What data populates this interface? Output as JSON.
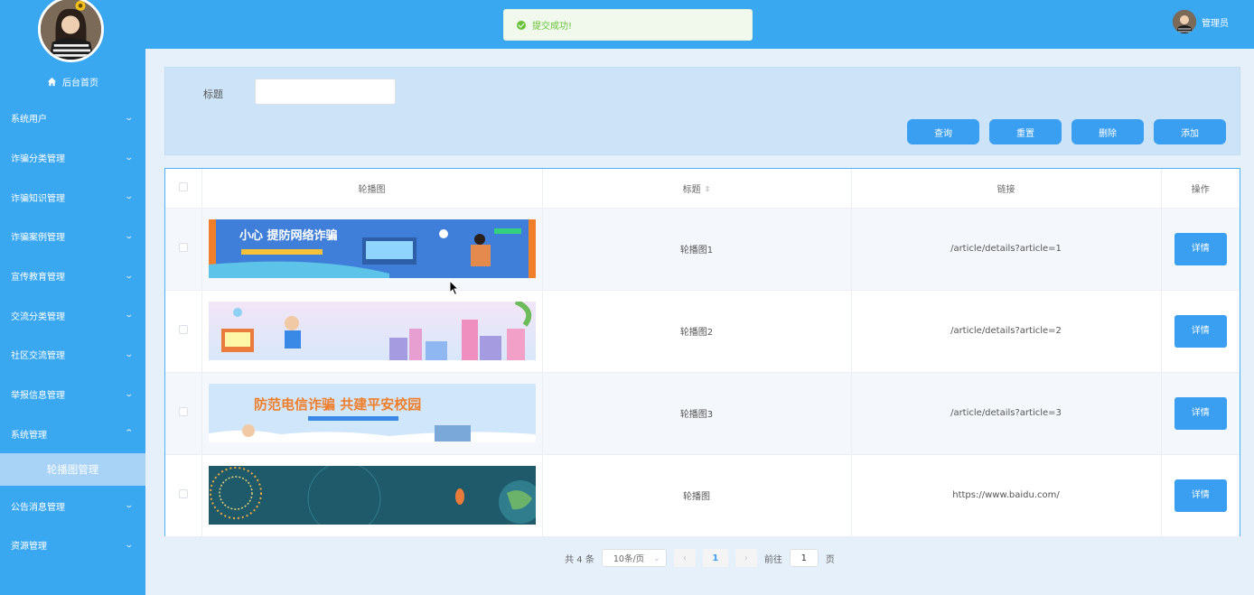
{
  "toast": {
    "message": "提交成功!"
  },
  "header": {
    "username": "管理员"
  },
  "sidebar": {
    "home_label": "后台首页",
    "items": [
      {
        "label": "系统用户",
        "chevron": "⌄"
      },
      {
        "label": "诈骗分类管理",
        "chevron": "⌄"
      },
      {
        "label": "诈骗知识管理",
        "chevron": "⌄"
      },
      {
        "label": "诈骗案例管理",
        "chevron": "⌄"
      },
      {
        "label": "宣传教育管理",
        "chevron": "⌄"
      },
      {
        "label": "交流分类管理",
        "chevron": "⌄"
      },
      {
        "label": "社区交流管理",
        "chevron": "⌄"
      },
      {
        "label": "举报信息管理",
        "chevron": "⌄"
      },
      {
        "label": "系统管理",
        "chevron": "⌃"
      }
    ],
    "sub_item": "轮播图管理",
    "items_after": [
      {
        "label": "公告消息管理",
        "chevron": "⌄"
      },
      {
        "label": "资源管理",
        "chevron": "⌄"
      }
    ]
  },
  "search": {
    "label": "标题",
    "value": "",
    "buttons": {
      "query": "查询",
      "reset": "重置",
      "delete": "删除",
      "add": "添加"
    }
  },
  "table": {
    "headers": {
      "image": "轮播图",
      "title": "标题",
      "link": "链接",
      "action": "操作"
    },
    "sort_icon": "⇕",
    "rows": [
      {
        "title": "轮播图1",
        "link": "/article/details?article=1",
        "action": "详情",
        "banner_text": "小心  提防网络诈骗"
      },
      {
        "title": "轮播图2",
        "link": "/article/details?article=2",
        "action": "详情",
        "banner_text": ""
      },
      {
        "title": "轮播图3",
        "link": "/article/details?article=3",
        "action": "详情",
        "banner_text": "防范电信诈骗  共建平安校园"
      },
      {
        "title": "轮播图",
        "link": "https://www.baidu.com/",
        "action": "详情",
        "banner_text": ""
      }
    ]
  },
  "pagination": {
    "total": "共 4 条",
    "page_size": "10条/页",
    "prev": "‹",
    "current": "1",
    "next": "›",
    "goto_label": "前往",
    "goto_value": "1",
    "goto_suffix": "页"
  }
}
